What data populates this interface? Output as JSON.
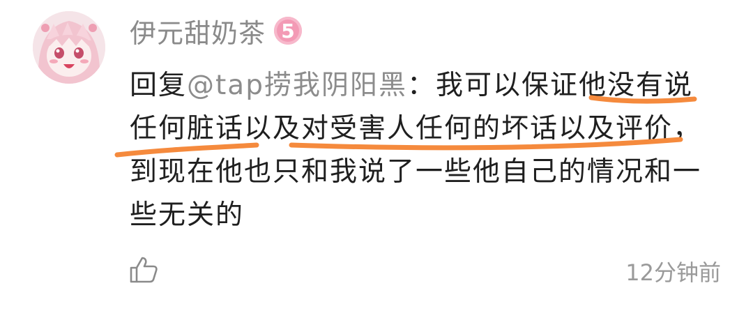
{
  "comment": {
    "username": "伊元甜奶茶",
    "level": "5",
    "reply_prefix": "回复",
    "mention": "@tap捞我阴阳黑",
    "body_text": "：我可以保证他没有说任何脏话以及对受害人任何的坏话以及评价，到现在他也只和我说了一些他自己的情况和一些无关的",
    "timestamp": "12分钟前",
    "highlight_color": "#f58a3d",
    "mention_color": "#8c8c8c",
    "badge_color": "#f39ab5"
  }
}
